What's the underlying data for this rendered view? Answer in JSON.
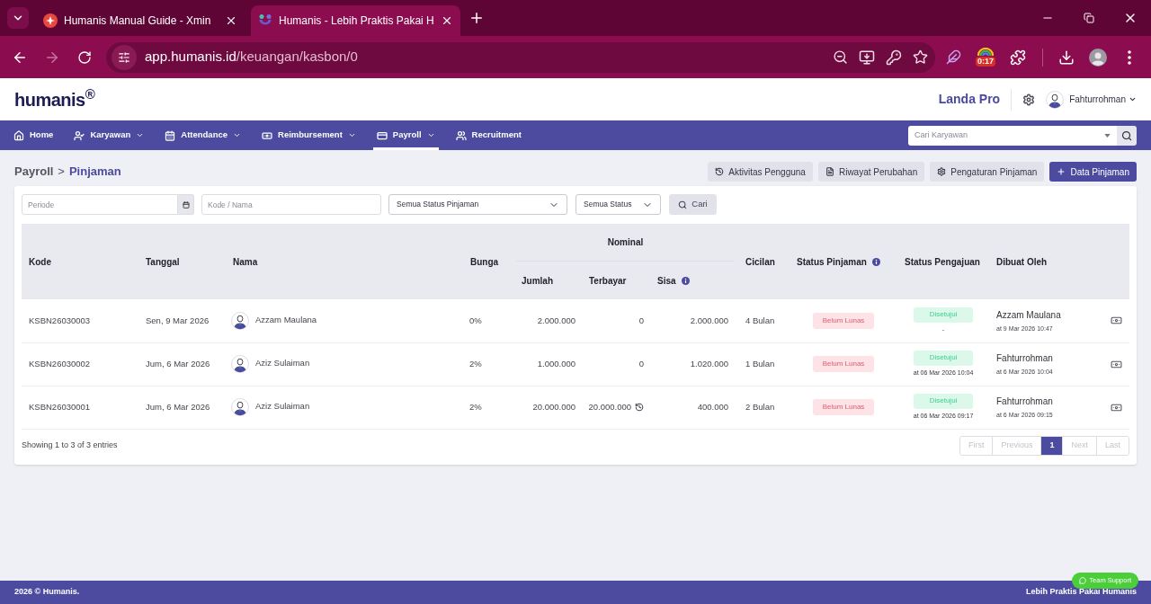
{
  "browser": {
    "tabs": [
      {
        "title": "Humanis Manual Guide - Xmin",
        "selected": false
      },
      {
        "title": "Humanis - Lebih Praktis Pakai H",
        "selected": true
      }
    ],
    "address": {
      "host": "app.humanis.id",
      "path": "/keuangan/kasbon/0"
    },
    "extension_badge": "0:17"
  },
  "header": {
    "logo": "humanis$^{®}$",
    "company": "Landa Pro",
    "user": "Fahturrohman"
  },
  "nav": {
    "items": [
      {
        "label": "Home",
        "dropdown": false,
        "selected": false
      },
      {
        "label": "Karyawan",
        "dropdown": true,
        "selected": false
      },
      {
        "label": "Attendance",
        "dropdown": true,
        "selected": false
      },
      {
        "label": "Reimbursement",
        "dropdown": true,
        "selected": false
      },
      {
        "label": "Payroll",
        "dropdown": true,
        "selected": true
      },
      {
        "label": "Recruitment",
        "dropdown": false,
        "selected": false
      }
    ],
    "search": {
      "placeholder": "Cari Karyawan"
    }
  },
  "breadcrumb": {
    "parent": "Payroll",
    "separator": ">",
    "current": "Pinjaman"
  },
  "actions": [
    {
      "label": "Aktivitas Pengguna",
      "kind": "secondary"
    },
    {
      "label": "Riwayat Perubahan",
      "kind": "secondary"
    },
    {
      "label": "Pengaturan Pinjaman",
      "kind": "secondary"
    },
    {
      "label": "Data Pinjaman",
      "kind": "primary"
    }
  ],
  "filters": {
    "periode": {
      "placeholder": "Periode"
    },
    "kode_nama": {
      "placeholder": "Kode / Nama"
    },
    "status_pinjaman": {
      "value": "Semua Status Pinjaman"
    },
    "status": {
      "value": "Semua Status"
    },
    "search_button": "Cari"
  },
  "table": {
    "columns": [
      {
        "label": "Kode",
        "info": false
      },
      {
        "label": "Tanggal",
        "info": false
      },
      {
        "label": "Nama",
        "info": false
      },
      {
        "label": "Bunga",
        "info": false
      },
      {
        "label": "Nominal",
        "info": false,
        "children": [
          {
            "label": "Jumlah",
            "info": false
          },
          {
            "label": "Terbayar",
            "info": false
          },
          {
            "label": "Sisa",
            "info": true
          }
        ]
      },
      {
        "label": "Cicilan",
        "info": false
      },
      {
        "label": "Status Pinjaman",
        "info": true
      },
      {
        "label": "Status Pengajuan",
        "info": false
      },
      {
        "label": "Dibuat Oleh",
        "info": false
      }
    ],
    "rows": [
      {
        "kode": "KSBN26030003",
        "tanggal": "Sen, 9 Mar 2026",
        "nama": "Azzam Maulana",
        "bunga": "0%",
        "jumlah": "2.000.000",
        "terbayar": "0",
        "terbayar_history": false,
        "sisa": "2.000.000",
        "cicilan": "4 Bulan",
        "status_pinjaman": "Belum Lunas",
        "status_pengajuan": "Disetujui",
        "pengajuan_at": "-",
        "dibuat_oleh": "Azzam Maulana",
        "dibuat_at": "at 9 Mar 2026 10:47"
      },
      {
        "kode": "KSBN26030002",
        "tanggal": "Jum, 6 Mar 2026",
        "nama": "Aziz Sulaiman",
        "bunga": "2%",
        "jumlah": "1.000.000",
        "terbayar": "0",
        "terbayar_history": false,
        "sisa": "1.020.000",
        "cicilan": "1 Bulan",
        "status_pinjaman": "Belum Lunas",
        "status_pengajuan": "Disetujui",
        "pengajuan_at": "at 06 Mar 2026 10:04",
        "dibuat_oleh": "Fahturrohman",
        "dibuat_at": "at 6 Mar 2026 10:04"
      },
      {
        "kode": "KSBN26030001",
        "tanggal": "Jum, 6 Mar 2026",
        "nama": "Aziz Sulaiman",
        "bunga": "2%",
        "jumlah": "20.000.000",
        "terbayar": "20.000.000",
        "terbayar_history": true,
        "sisa": "400.000",
        "cicilan": "2 Bulan",
        "status_pinjaman": "Belum Lunas",
        "status_pengajuan": "Disetujui",
        "pengajuan_at": "at 06 Mar 2026 09:17",
        "dibuat_oleh": "Fahturrohman",
        "dibuat_at": "at 6 Mar 2026 09:15"
      }
    ]
  },
  "table_footer": {
    "info": "Showing 1 to 3 of 3 entries",
    "pagination": [
      {
        "label": "First",
        "disabled": true,
        "selected": false
      },
      {
        "label": "Previous",
        "disabled": true,
        "selected": false
      },
      {
        "label": "1",
        "disabled": false,
        "selected": true
      },
      {
        "label": "Next",
        "disabled": true,
        "selected": false
      },
      {
        "label": "Last",
        "disabled": true,
        "selected": false
      }
    ]
  },
  "footer": {
    "copyright": "2026 © Humanis.",
    "tagline": "Lebih Praktis Pakai Humanis",
    "support_button": "Team Support"
  }
}
